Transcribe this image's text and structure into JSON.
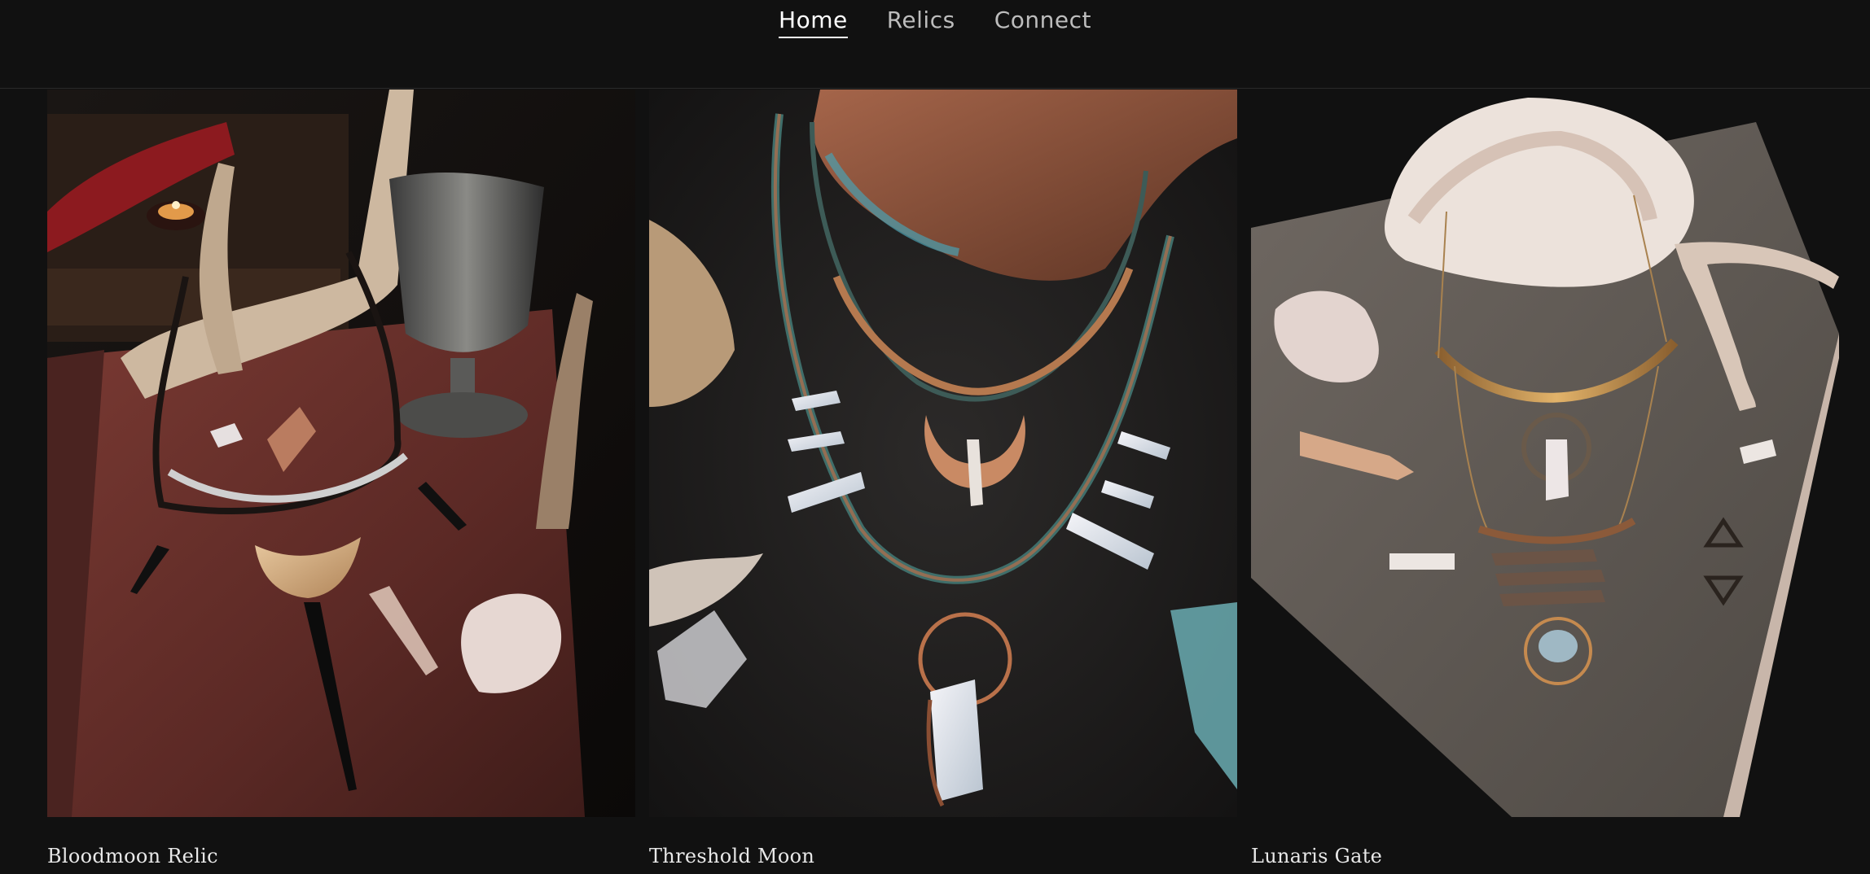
{
  "nav": {
    "items": [
      {
        "label": "Home",
        "active": true
      },
      {
        "label": "Relics",
        "active": false
      },
      {
        "label": "Connect",
        "active": false
      }
    ]
  },
  "products": [
    {
      "title": "Bloodmoon Relic"
    },
    {
      "title": "Threshold Moon"
    },
    {
      "title": "Lunaris Gate"
    }
  ],
  "colors": {
    "background": "#111111",
    "nav_text": "#bdbdbd",
    "nav_active": "#ffffff",
    "title_text": "#e8e8e8"
  }
}
